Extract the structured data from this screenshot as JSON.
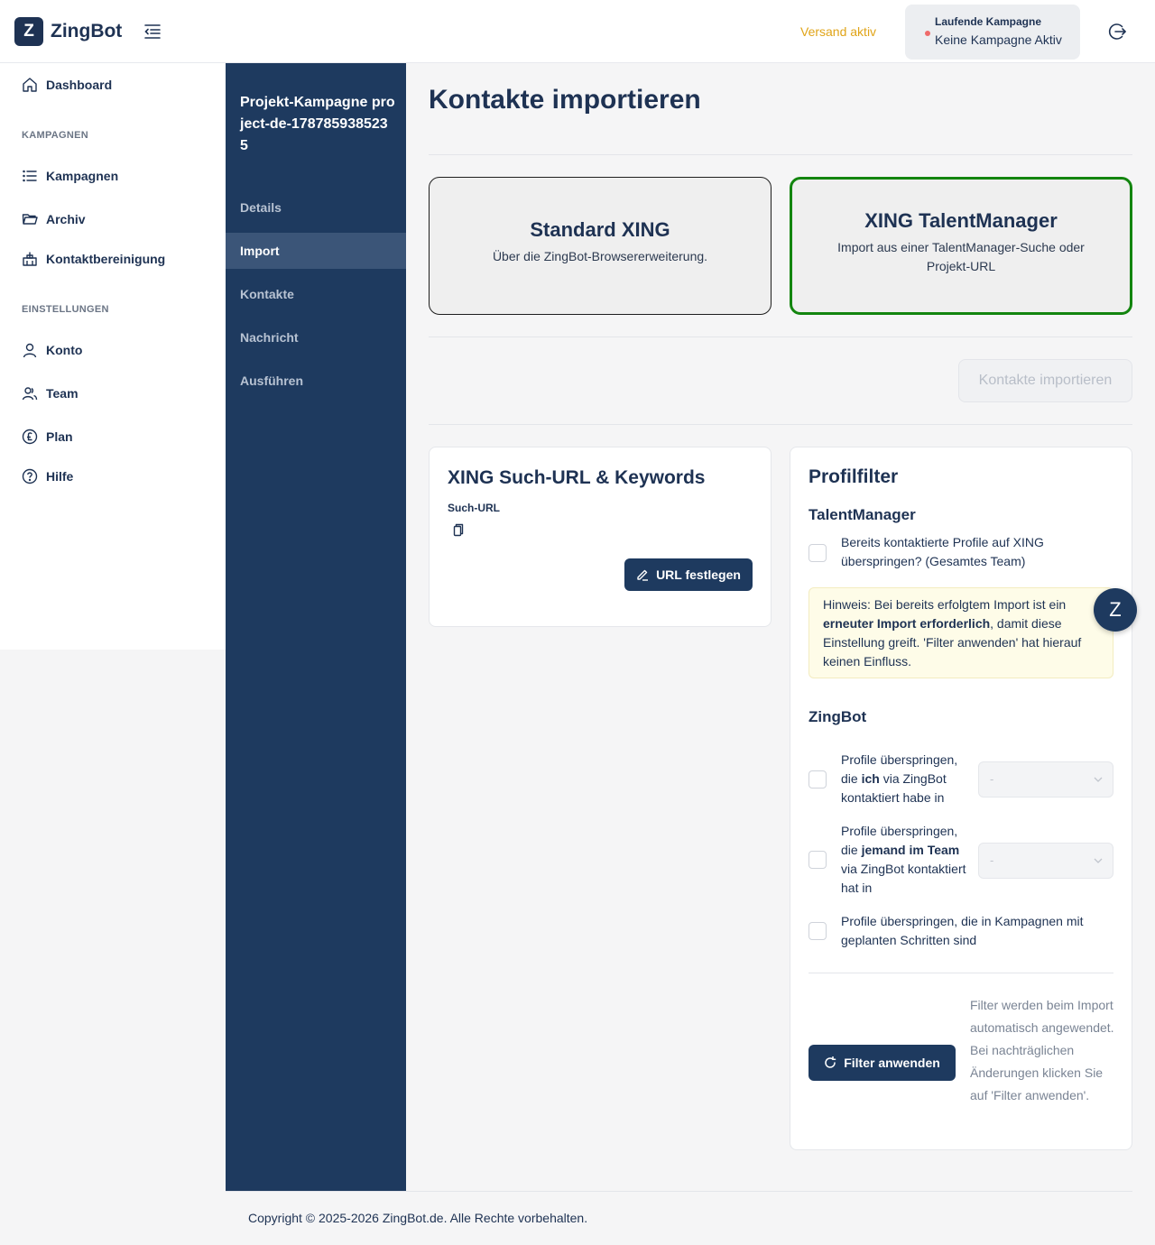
{
  "header": {
    "logo_letter": "Z",
    "app_name": "ZingBot",
    "status": "Versand aktiv",
    "campaign_label": "Laufende Kampagne",
    "campaign_value": "Keine Kampagne Aktiv"
  },
  "sidebar": {
    "dashboard": "Dashboard",
    "section_campaigns": "KAMPAGNEN",
    "campaigns": "Kampagnen",
    "archive": "Archiv",
    "cleanup": "Kontaktbereinigung",
    "section_settings": "EINSTELLUNGEN",
    "account": "Konto",
    "team": "Team",
    "plan": "Plan",
    "help": "Hilfe"
  },
  "campaign_nav": {
    "title": "Projekt-Kampagne project-de-1787859385235",
    "items": [
      "Details",
      "Import",
      "Kontakte",
      "Nachricht",
      "Ausführen"
    ],
    "active": "Import"
  },
  "main": {
    "title": "Kontakte importieren",
    "option_standard": {
      "title": "Standard XING",
      "desc": "Über die ZingBot-Browsererweiterung."
    },
    "option_talent": {
      "title": "XING TalentManager",
      "desc": "Import aus einer TalentManager-Suche oder Projekt-URL"
    },
    "import_button": "Kontakte importieren"
  },
  "search_panel": {
    "title": "XING Such-URL & Keywords",
    "url_label": "Such-URL",
    "set_url_button": "URL festlegen"
  },
  "filter_panel": {
    "title": "Profilfilter",
    "tm_heading": "TalentManager",
    "tm_checkbox": "Bereits kontaktierte Profile auf XING überspringen? (Gesamtes Team)",
    "hint_prefix": "Hinweis: Bei bereits erfolgtem Import ist ein ",
    "hint_bold": "erneuter Import erforderlich",
    "hint_suffix": ", damit diese Einstellung greift. 'Filter anwenden' hat hierauf keinen Einfluss.",
    "zb_heading": "ZingBot",
    "zb_opt1_a": "Profile überspringen, die ",
    "zb_opt1_b": "ich",
    "zb_opt1_c": " via ZingBot kontaktiert habe in",
    "zb_opt2_a": "Profile überspringen, die ",
    "zb_opt2_b": "jemand im Team",
    "zb_opt2_c": " via ZingBot kontaktiert hat in",
    "zb_opt3": "Profile überspringen, die in Kampagnen mit geplanten Schritten sind",
    "select_placeholder": "-",
    "apply_button": "Filter anwenden",
    "apply_note": "Filter werden beim Import automatisch angewendet. Bei nachträglichen Änderungen klicken Sie auf 'Filter anwenden'."
  },
  "chat_fab": "Z",
  "footer": "Copyright © 2025-2026 ZingBot.de. Alle Rechte vorbehalten.",
  "colors": {
    "primary": "#1e3a5f",
    "status": "#e0a418",
    "selected_border": "#13850f",
    "hint_bg": "#fefce8"
  }
}
